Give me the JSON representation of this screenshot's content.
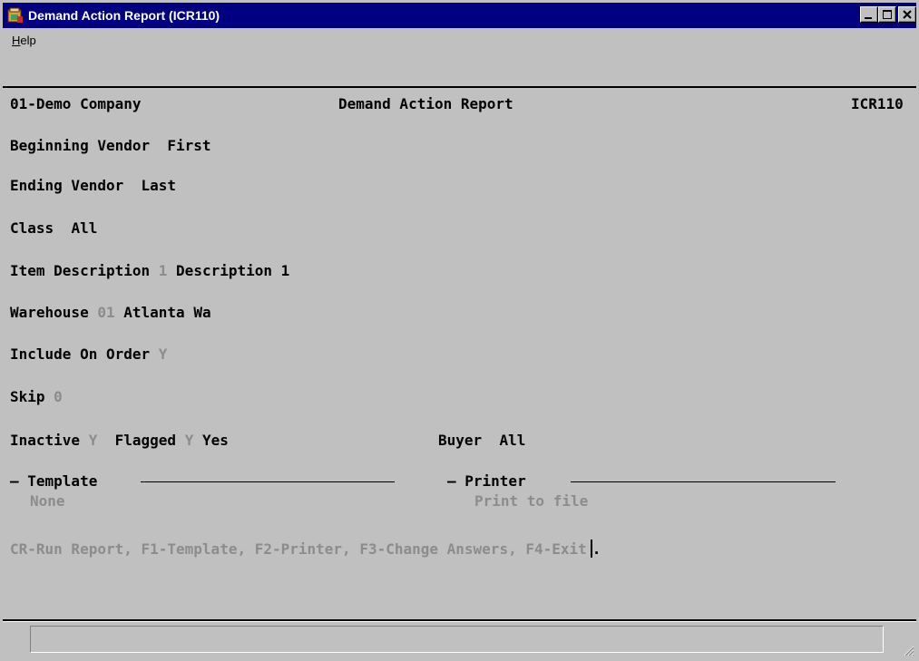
{
  "window": {
    "title": "Demand Action Report (ICR110)",
    "title_bar_color": "#000080"
  },
  "menu": {
    "help_accel": "H",
    "help_rest": "elp"
  },
  "header": {
    "company": "01-Demo Company",
    "report_name": "Demand Action Report",
    "program_code": "ICR110"
  },
  "fields": {
    "beginning_vendor": {
      "label": "Beginning Vendor",
      "value": "First"
    },
    "ending_vendor": {
      "label": "Ending Vendor",
      "value": "Last"
    },
    "class": {
      "label": "Class",
      "value": "All"
    },
    "item_description": {
      "label": "Item Description",
      "code": "1",
      "value": "Description 1"
    },
    "warehouse": {
      "label": "Warehouse",
      "code": "01",
      "value": "Atlanta Wa"
    },
    "include_on_order": {
      "label": "Include On Order",
      "code": "Y"
    },
    "skip": {
      "label": "Skip",
      "code": "0"
    },
    "inactive": {
      "label": "Inactive",
      "code": "Y"
    },
    "flagged": {
      "label": "Flagged",
      "code": "Y",
      "value": "Yes"
    },
    "buyer": {
      "label": "Buyer",
      "value": "All"
    }
  },
  "template_section": {
    "title": "Template",
    "value": "None"
  },
  "printer_section": {
    "title": "Printer",
    "value": "Print to file"
  },
  "prompt": "CR-Run Report, F1-Template, F2-Printer, F3-Change Answers, F4-Exit",
  "colors": {
    "dim_text": "#8c8c8c",
    "background": "#c0c0c0"
  },
  "icons": {
    "app": "app-icon",
    "minimize": "minimize-icon",
    "maximize": "maximize-icon",
    "close": "close-icon",
    "grip": "resize-grip-icon"
  }
}
